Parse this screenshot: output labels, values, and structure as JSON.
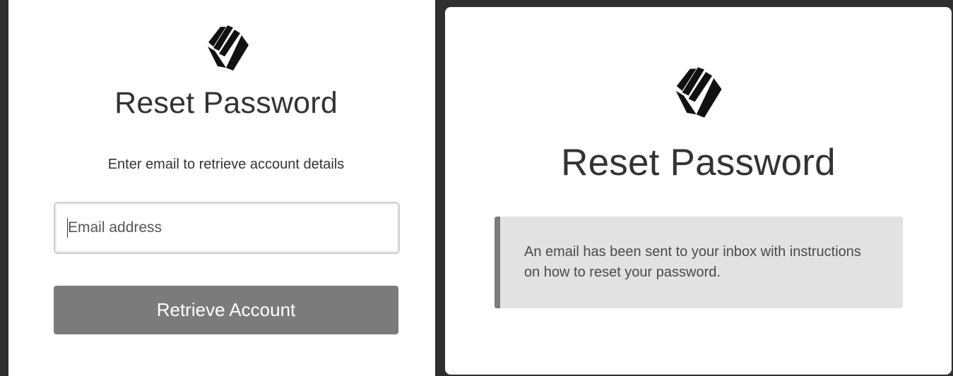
{
  "left_panel": {
    "logo_icon": "brand-logo-icon",
    "title": "Reset Password",
    "subtitle": "Enter email to retrieve account details",
    "email_input": {
      "placeholder": "Email address",
      "value": ""
    },
    "retrieve_button_label": "Retrieve Account"
  },
  "right_panel": {
    "logo_icon": "brand-logo-icon",
    "title": "Reset Password",
    "notice_text": "An email has been sent to your inbox with instructions on how to reset your password."
  },
  "colors": {
    "background": "#2f2f2f",
    "panel": "#ffffff",
    "text": "#333333",
    "button": "#7b7b7b",
    "notice_bg": "#e2e2e2",
    "notice_accent": "#7b7b7b"
  }
}
